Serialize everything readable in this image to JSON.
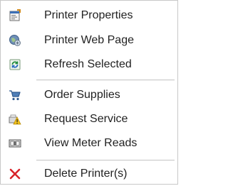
{
  "menu": {
    "items": [
      {
        "label": "Printer Properties",
        "icon": "printer-properties-icon"
      },
      {
        "label": "Printer Web Page",
        "icon": "globe-web-icon"
      },
      {
        "label": "Refresh Selected",
        "icon": "refresh-icon"
      },
      {
        "label": "Order Supplies",
        "icon": "shopping-cart-icon"
      },
      {
        "label": "Request Service",
        "icon": "service-warning-icon"
      },
      {
        "label": "View Meter Reads",
        "icon": "meter-reads-icon"
      },
      {
        "label": "Delete Printer(s)",
        "icon": "delete-x-icon"
      }
    ]
  }
}
